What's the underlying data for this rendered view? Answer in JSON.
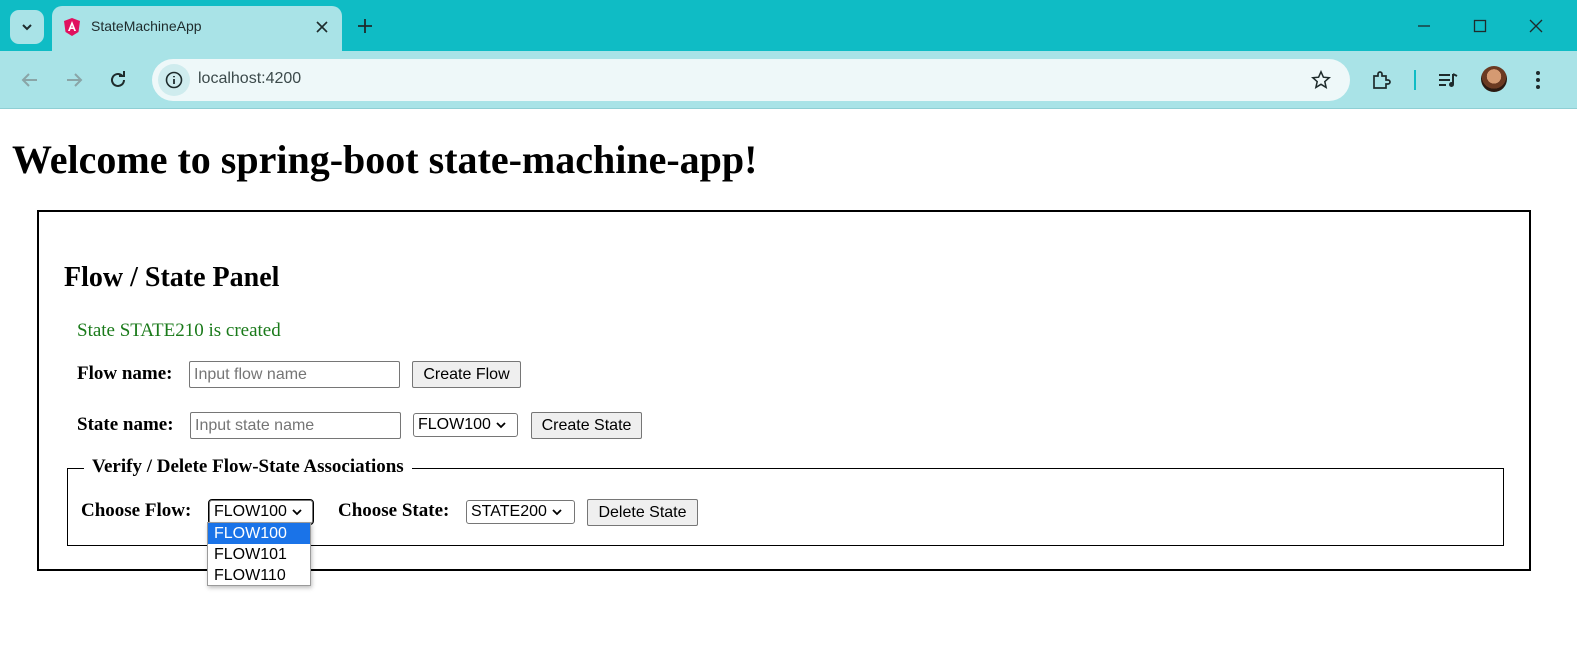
{
  "browser": {
    "tab_title": "StateMachineApp",
    "url": "localhost:4200"
  },
  "page": {
    "heading": "Welcome to spring-boot state-machine-app!",
    "panel_title": "Flow / State Panel",
    "status_message": "State STATE210 is created",
    "status_color": "#1a7a1a",
    "flow_form": {
      "label": "Flow name:",
      "placeholder": "Input flow name",
      "button": "Create Flow"
    },
    "state_form": {
      "label": "State name:",
      "placeholder": "Input state name",
      "flow_select_value": "FLOW100",
      "button": "Create State"
    },
    "verify_section": {
      "legend": "Verify / Delete Flow-State Associations",
      "choose_flow_label": "Choose Flow:",
      "flow_select_value": "FLOW100",
      "choose_state_label": "Choose State:",
      "state_select_value": "STATE200",
      "delete_button": "Delete State",
      "flow_options": [
        "FLOW100",
        "FLOW101",
        "FLOW110"
      ],
      "highlighted_option": "FLOW100"
    }
  },
  "colors": {
    "tabbar": "#0fbcc5",
    "toolbar": "#a9e3e7",
    "dropdown_highlight": "#1a73e8"
  }
}
